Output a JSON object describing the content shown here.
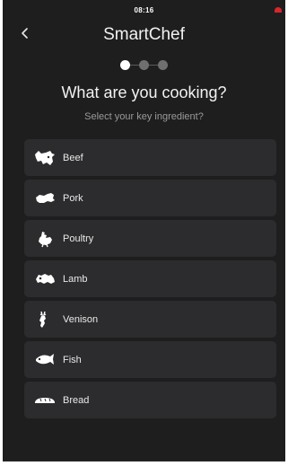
{
  "status": {
    "time": "08:16"
  },
  "header": {
    "back_icon": "chevron-left-icon",
    "title": "SmartChef"
  },
  "pager": {
    "total": 3,
    "current": 1
  },
  "main": {
    "heading": "What are you cooking?",
    "subheading": "Select your key ingredient?"
  },
  "ingredients": [
    {
      "label": "Beef",
      "icon": "cow-icon"
    },
    {
      "label": "Pork",
      "icon": "pig-icon"
    },
    {
      "label": "Poultry",
      "icon": "chicken-icon"
    },
    {
      "label": "Lamb",
      "icon": "sheep-icon"
    },
    {
      "label": "Venison",
      "icon": "deer-icon"
    },
    {
      "label": "Fish",
      "icon": "fish-icon"
    },
    {
      "label": "Bread",
      "icon": "bread-icon"
    }
  ],
  "colors": {
    "background": "#1e1e1f",
    "card": "#2c2c2e",
    "accent_red": "#d8262c"
  }
}
